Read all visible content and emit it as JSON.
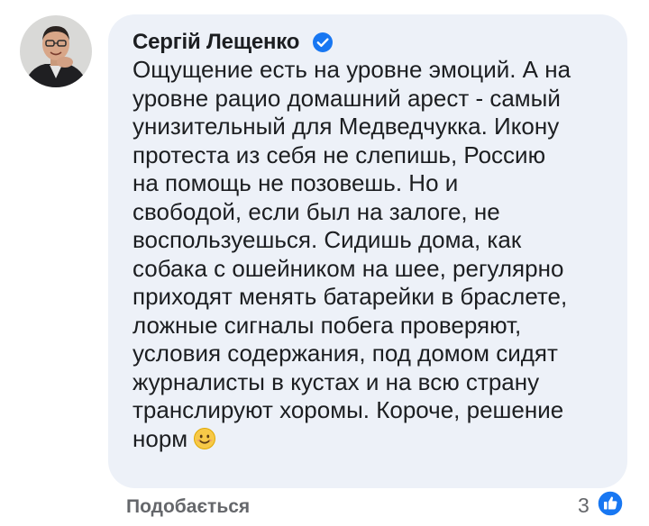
{
  "comment": {
    "author": "Сергій Лещенко",
    "verified_icon": "verified-badge-icon",
    "text_lines": [
      "Ощущение есть на уровне эмоций. А на",
      "уровне рацио домашний арест - самый",
      "унизительный для Медведчукка. Икону",
      "протеста из себя не слепишь, Россию",
      "на помощь не позовешь. Но и",
      "свободой, если был на залоге, не",
      "воспользуешься. Сидишь дома, как",
      "собака с ошейником на шее, регулярно",
      "приходят менять батарейки в браслете,",
      "ложные сигналы побега проверяют,",
      "условия содержания, под домом сидят",
      "журналисты в кустах и на всю страну",
      "транслируют хоромы. Короче, решение",
      "норм"
    ],
    "emoji": "smiling-face-emoji"
  },
  "actions": {
    "like_label": "Подобається",
    "reaction_count": "3",
    "reaction_icon": "thumbs-up-icon"
  },
  "colors": {
    "bubble_bg": "#edf1f8",
    "accent_blue": "#1877f2",
    "text": "#1c1e21",
    "muted": "#65676b"
  }
}
